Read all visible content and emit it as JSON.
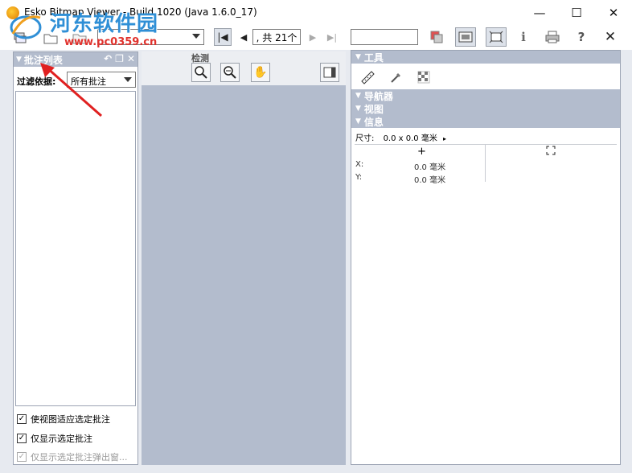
{
  "window": {
    "title": "Esko Bitmap Viewer - Build 1020 (Java 1.6.0_17)",
    "minimize_glyph": "—",
    "maximize_glyph": "☐",
    "close_glyph": "✕"
  },
  "watermark": {
    "site_name": "河东软件园",
    "url": "www.pc0359.cn"
  },
  "toolbar": {
    "page_total": ", 共 21个",
    "icons": [
      "layers-icon",
      "open-folder-icon",
      "folder-icon",
      "first-page-icon",
      "prev-page-icon",
      "next-page-icon",
      "last-page-icon",
      "compare-icon",
      "screen-icon",
      "fit-icon",
      "info-icon",
      "print-icon",
      "help-icon",
      "close-icon"
    ],
    "info_glyph": "i",
    "help_glyph": "?",
    "close_glyph": "✕"
  },
  "left_panel": {
    "title": "批注列表",
    "filter_label": "过滤依据:",
    "filter_value": "所有批注",
    "checkboxes": [
      {
        "label": "使视图适应选定批注",
        "checked": true,
        "enabled": true
      },
      {
        "label": "仅显示选定批注",
        "checked": true,
        "enabled": true
      },
      {
        "label": "仅显示选定批注弹出窗...",
        "checked": true,
        "enabled": false
      }
    ]
  },
  "center": {
    "inspect_label": "检测"
  },
  "right_panel": {
    "sections": {
      "tools": "工具",
      "navigator": "导航器",
      "view": "视图",
      "info": "信息"
    },
    "info": {
      "size_label": "尺寸:",
      "size_value": "0.0 x 0.0 毫米",
      "x_label": "X:",
      "x_value": "0.0 毫米",
      "y_label": "Y:",
      "y_value": "0.0 毫米"
    }
  },
  "colors": {
    "panel_header": "#b3bccd",
    "canvas": "#b3bccd",
    "annotation_arrow": "#e02020",
    "watermark_blue": "#2f8fd6",
    "watermark_red": "#e0322d"
  }
}
